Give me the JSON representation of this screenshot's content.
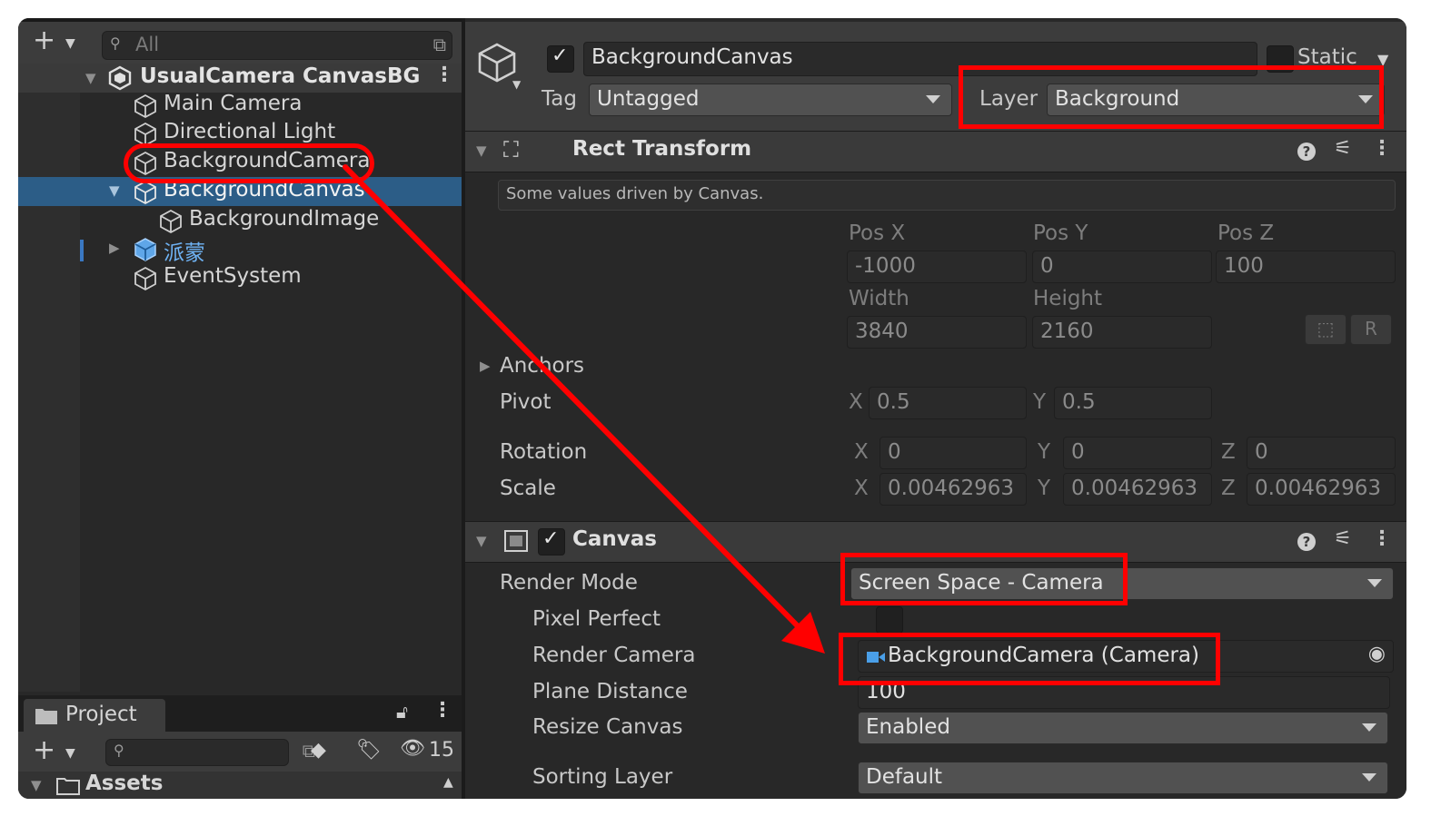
{
  "hierarchy": {
    "search_placeholder": "All",
    "scene_name": "UsualCamera CanvasBG",
    "items": [
      {
        "label": "Main Camera"
      },
      {
        "label": "Directional Light"
      },
      {
        "label": "BackgroundCamera"
      },
      {
        "label": "BackgroundCanvas"
      },
      {
        "label": "BackgroundImage"
      },
      {
        "label": "派蒙"
      },
      {
        "label": "EventSystem"
      }
    ]
  },
  "project": {
    "tab_label": "Project",
    "hidden_count": "15",
    "assets_label": "Assets"
  },
  "inspector": {
    "object_name": "BackgroundCanvas",
    "static_label": "Static",
    "tag_label": "Tag",
    "tag_value": "Untagged",
    "layer_label": "Layer",
    "layer_value": "Background",
    "rect_transform": {
      "title": "Rect Transform",
      "info": "Some values driven by Canvas.",
      "pos_x_label": "Pos X",
      "pos_y_label": "Pos Y",
      "pos_z_label": "Pos Z",
      "pos_x": "-1000",
      "pos_y": "0",
      "pos_z": "100",
      "width_label": "Width",
      "height_label": "Height",
      "width": "3840",
      "height": "2160",
      "r_button": "R",
      "anchors_label": "Anchors",
      "pivot_label": "Pivot",
      "pivot_x": "0.5",
      "pivot_y": "0.5",
      "rotation_label": "Rotation",
      "rot_x": "0",
      "rot_y": "0",
      "rot_z": "0",
      "scale_label": "Scale",
      "scale_x": "0.00462963",
      "scale_y": "0.00462963",
      "scale_z": "0.00462963",
      "axis_x": "X",
      "axis_y": "Y",
      "axis_z": "Z"
    },
    "canvas": {
      "title": "Canvas",
      "render_mode_label": "Render Mode",
      "render_mode_value": "Screen Space - Camera",
      "pixel_perfect_label": "Pixel Perfect",
      "render_camera_label": "Render Camera",
      "render_camera_value": "BackgroundCamera (Camera)",
      "plane_distance_label": "Plane Distance",
      "plane_distance_value": "100",
      "resize_canvas_label": "Resize Canvas",
      "resize_canvas_value": "Enabled",
      "sorting_layer_label": "Sorting Layer",
      "sorting_layer_value": "Default"
    }
  },
  "colors": {
    "selection": "#2c5d87",
    "annotation": "#ff0000",
    "panel": "#282828"
  }
}
